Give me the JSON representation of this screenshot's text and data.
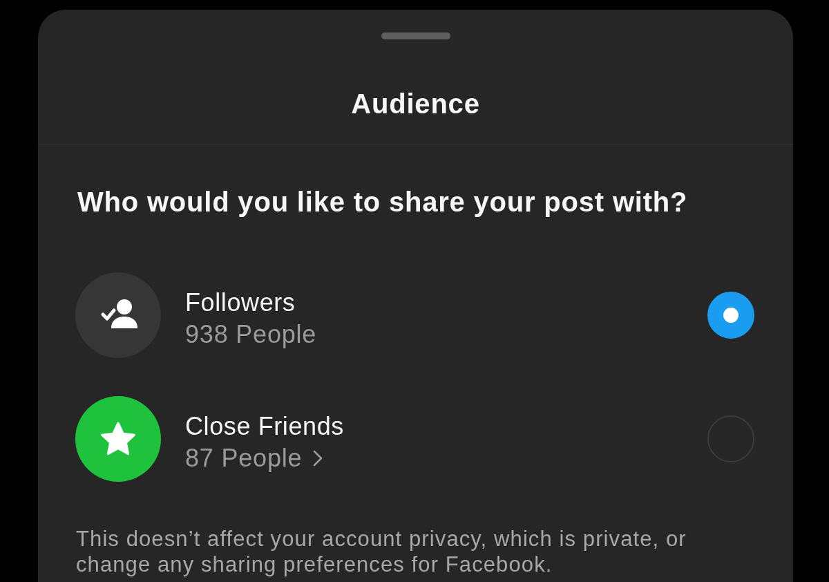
{
  "sheet": {
    "title": "Audience"
  },
  "question": "Who would you like to share your post with?",
  "options": [
    {
      "kind": "followers",
      "label": "Followers",
      "subtitle": "938 People",
      "color": "#363636",
      "chevron": false,
      "selected": true
    },
    {
      "kind": "close_friends",
      "label": "Close Friends",
      "subtitle": "87 People",
      "color": "#1fc23c",
      "chevron": true,
      "selected": false
    }
  ],
  "note": "This doesn’t affect your account privacy, which is private, or change any sharing preferences for Facebook."
}
